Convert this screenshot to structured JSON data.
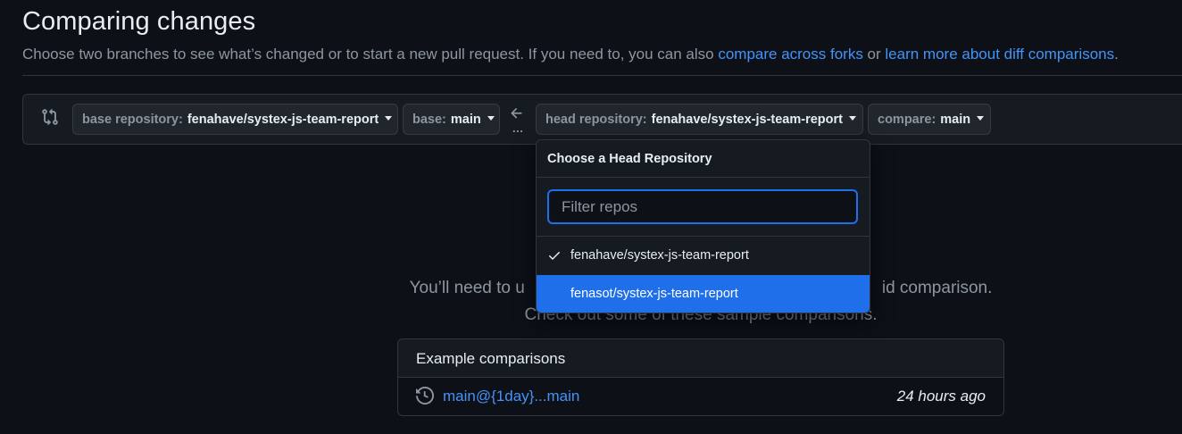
{
  "header": {
    "title": "Comparing changes",
    "subtitle_prefix": "Choose two branches to see what’s changed or to start a new pull request. If you need to, you can also ",
    "link_forks": "compare across forks",
    "subtitle_middle": " or ",
    "link_learn": "learn more about diff comparisons",
    "subtitle_suffix": "."
  },
  "range": {
    "base_repo_label": "base repository:",
    "base_repo_value": "fenahave/systex-js-team-report",
    "base_label": "base:",
    "base_value": "main",
    "arrow_icon": "arrow-left-icon",
    "dots": "...",
    "head_repo_label": "head repository:",
    "head_repo_value": "fenahave/systex-js-team-report",
    "compare_label": "compare:",
    "compare_value": "main"
  },
  "blankslate": {
    "line1_left": "You’ll need to u",
    "line1_right": "id comparison.",
    "line2": "Check out some of these sample comparisons."
  },
  "examples": {
    "header": "Example comparisons",
    "rows": [
      {
        "link": "main@{1day}...main",
        "time": "24 hours ago"
      }
    ]
  },
  "dropdown": {
    "title": "Choose a Head Repository",
    "filter_placeholder": "Filter repos",
    "filter_value": "",
    "items": [
      {
        "label": "fenahave/systex-js-team-report",
        "checked": true
      },
      {
        "label": "fenasot/systex-js-team-report",
        "checked": false
      }
    ]
  },
  "colors": {
    "background": "#0d1117",
    "accent": "#4493f8",
    "highlight": "#1f6feb",
    "muted": "#8d96a0"
  }
}
